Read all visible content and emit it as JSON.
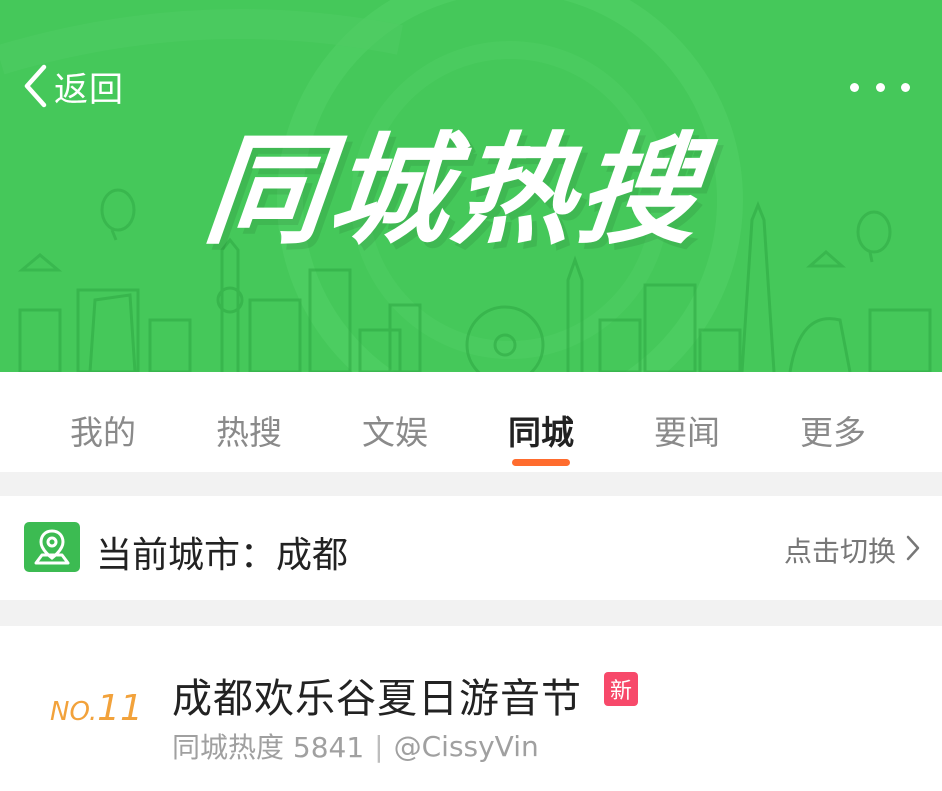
{
  "header": {
    "back_label": "返回",
    "title": "同城热搜"
  },
  "tabs": [
    {
      "label": "我的",
      "active": false
    },
    {
      "label": "热搜",
      "active": false
    },
    {
      "label": "文娱",
      "active": false
    },
    {
      "label": "同城",
      "active": true
    },
    {
      "label": "要闻",
      "active": false
    },
    {
      "label": "更多",
      "active": false
    }
  ],
  "city": {
    "label": "当前城市：成都",
    "switch_label": "点击切换"
  },
  "items": [
    {
      "rank_prefix": "NO.",
      "rank_number": "11",
      "title": "成都欢乐谷夏日游音节",
      "badge": "新",
      "heat_label": "同城热度 5841",
      "author": "@CissyVin"
    }
  ],
  "colors": {
    "banner_green": "#45c85a",
    "tab_underline": "#ff6c2e",
    "rank": "#f2a23b",
    "new_badge": "#f7496a",
    "city_icon_bg": "#3cbb52"
  },
  "icons": [
    "chevron-left-icon",
    "more-dots-icon",
    "location-map-icon",
    "chevron-right-icon"
  ]
}
